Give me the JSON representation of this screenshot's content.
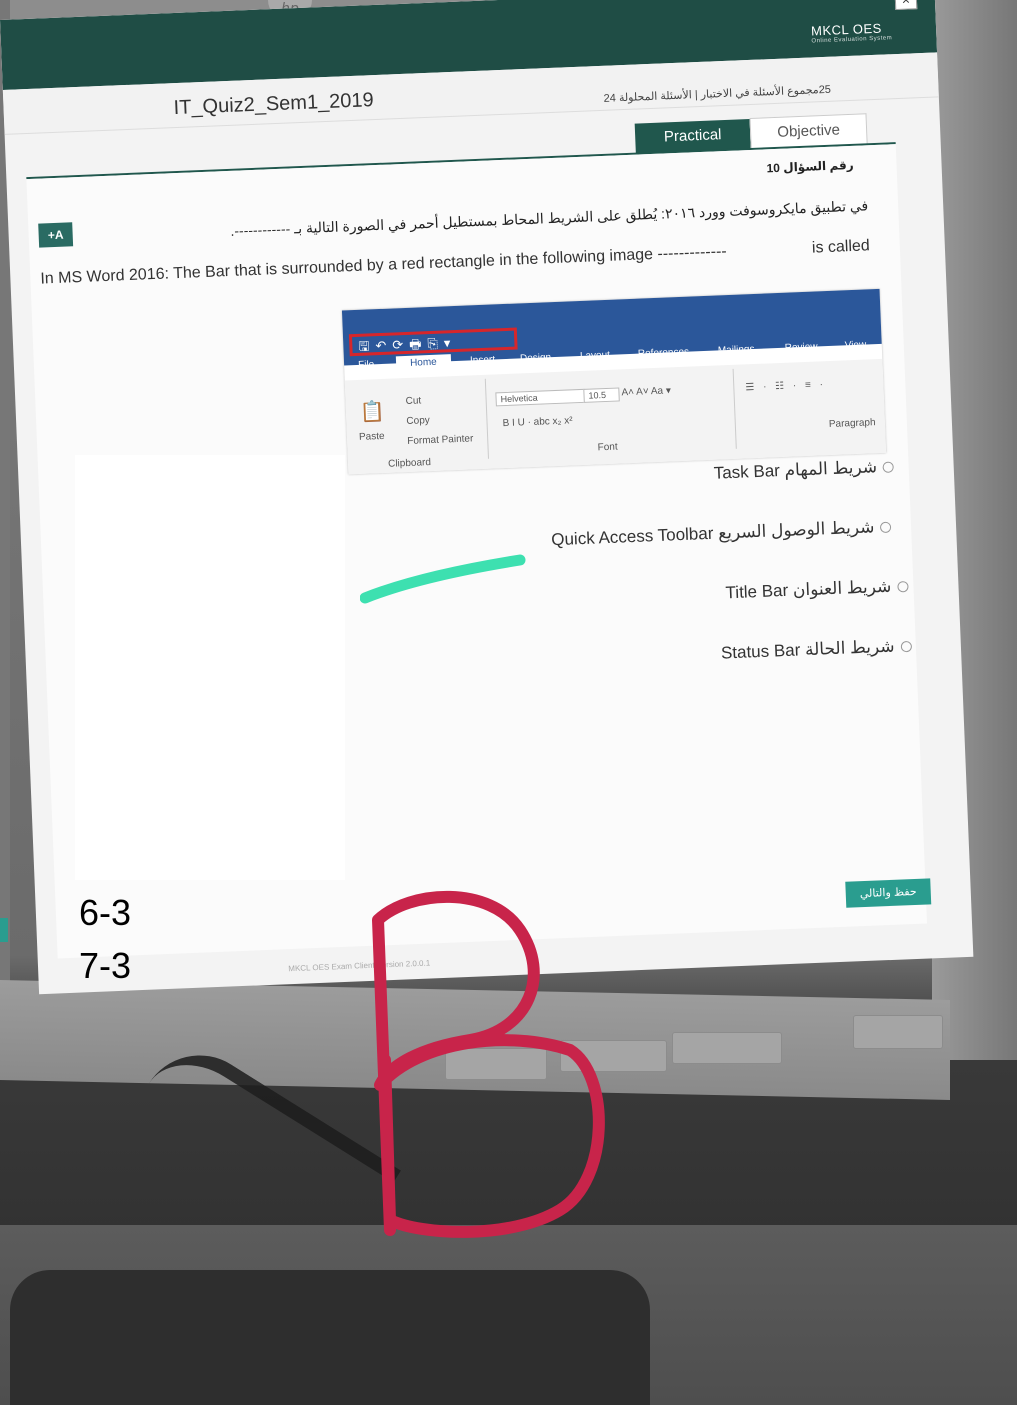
{
  "photo": {
    "logo_text": "hp"
  },
  "window": {
    "close_glyph": "×",
    "brand_name": "MKCL OES",
    "brand_tagline": "Online Evaluation System",
    "quiz_title": "IT_Quiz2_Sem1_2019",
    "question_count_text": "25مجموع الأسئلة في الاختبار | الأسئلة المحلولة 24"
  },
  "tabs": [
    {
      "label": "Practical",
      "active": true
    },
    {
      "label": "Objective",
      "active": false
    }
  ],
  "question": {
    "number_label": "رقم السؤال 10",
    "font_button": "+A",
    "text_ar": "في تطبيق مايكروسوفت وورد ٢٠١٦: يُطلق على الشريط المحاط بمستطيل أحمر في الصورة التالية بـ ------------.",
    "text_en": "In MS Word 2016: The Bar that is surrounded by a red rectangle in the following image -------------",
    "text_en_tail": "is called"
  },
  "word_image": {
    "qat_icons": "🖫↶⟳🖶⎘▾",
    "tabs": [
      "File",
      "Home",
      "Insert",
      "Design",
      "Layout",
      "References",
      "Mailings",
      "Review",
      "View"
    ],
    "clipboard": {
      "paste": "Paste",
      "cut": "Cut",
      "copy": "Copy",
      "format_painter": "Format Painter",
      "group": "Clipboard"
    },
    "font": {
      "name": "Helvetica",
      "size": "10.5",
      "group": "Font",
      "format_buttons": "B  I  U  ·  abc  x₂  x²",
      "grow_buttons": "A˄ A˅  Aa ▾"
    },
    "paragraph_group": "Paragraph"
  },
  "options": [
    {
      "text": "شريط المهام Task Bar"
    },
    {
      "text": "شريط الوصول السريع Quick Access Toolbar"
    },
    {
      "text": "شريط العنوان Title Bar"
    },
    {
      "text": "شريط الحالة Status Bar"
    }
  ],
  "save_button": "حفظ والتالي",
  "footer_version": "MKCL OES Exam Client Version 2.0.0.1",
  "notes": [
    "6-3",
    "7-3"
  ],
  "colors": {
    "accent_green": "#20574d",
    "teal_button": "#2a9d8f",
    "word_blue": "#2b579a",
    "qat_highlight_red": "#d6262b",
    "highlighter_green": "#3de0b0",
    "marker_red": "#c8244a"
  }
}
